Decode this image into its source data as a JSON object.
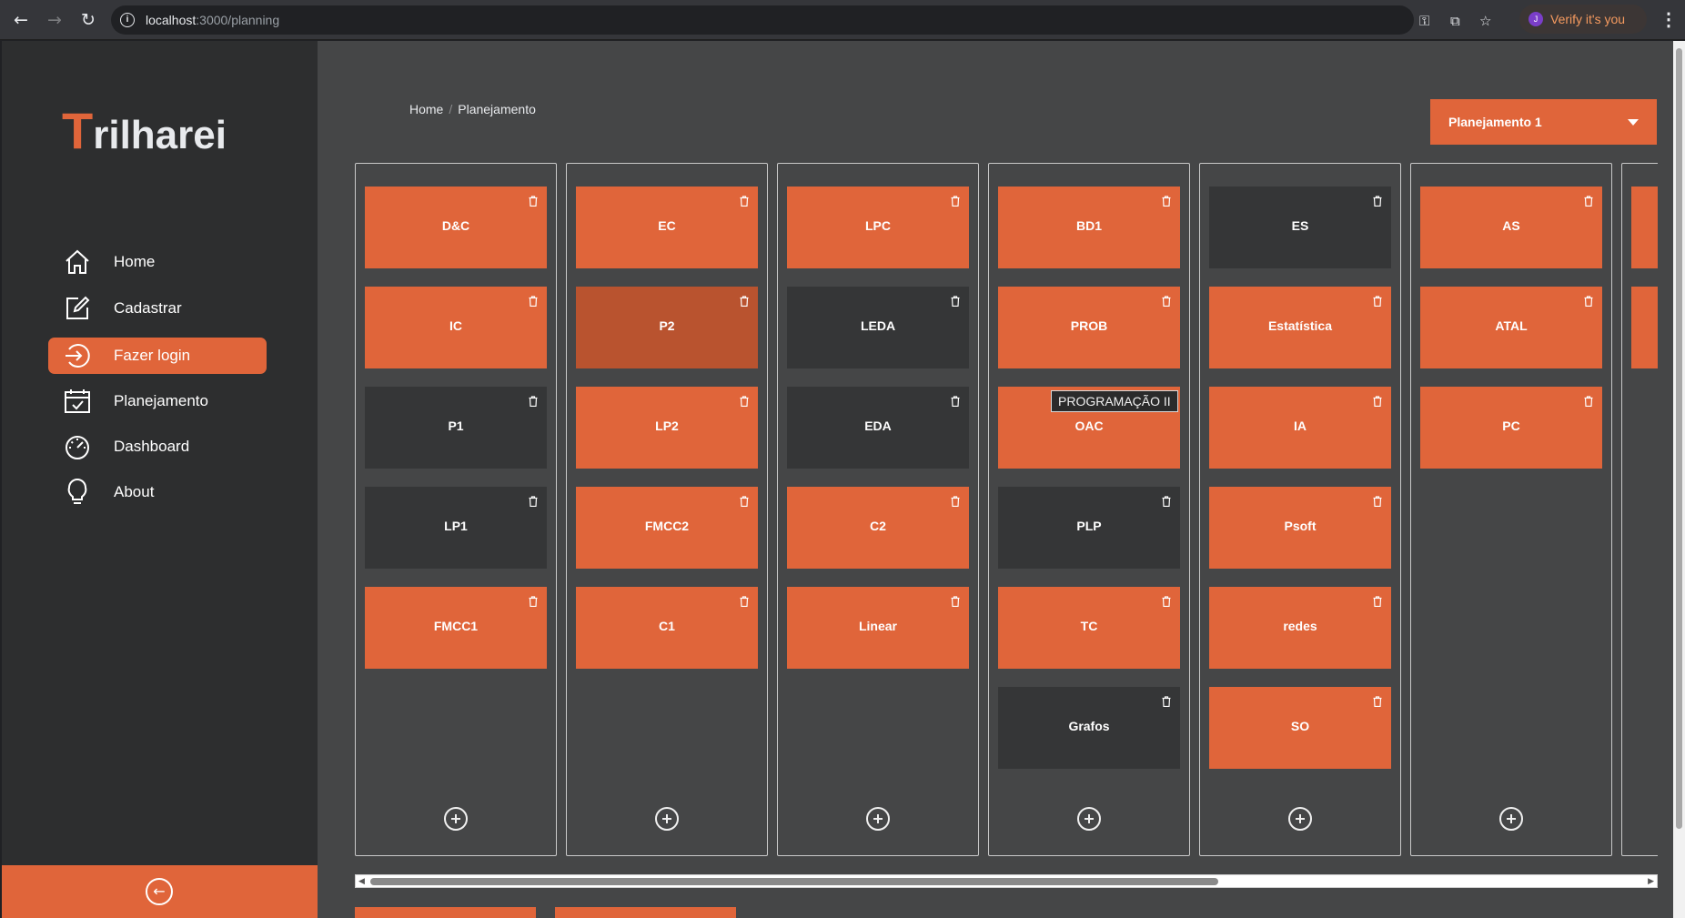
{
  "browser": {
    "url_host": "localhost",
    "url_path": ":3000/planning",
    "verify_label": "Verify it's you",
    "profile_initial": "J"
  },
  "sidebar": {
    "logo_initial": "T",
    "logo_rest": "rilharei",
    "items": [
      {
        "label": "Home",
        "icon": "home-icon"
      },
      {
        "label": "Cadastrar",
        "icon": "edit-icon"
      },
      {
        "label": "Fazer login",
        "icon": "login-icon",
        "active": true
      },
      {
        "label": "Planejamento",
        "icon": "calendar-check-icon"
      },
      {
        "label": "Dashboard",
        "icon": "speedometer-icon"
      },
      {
        "label": "About",
        "icon": "lightbulb-icon"
      }
    ]
  },
  "breadcrumb": {
    "home": "Home",
    "current": "Planejamento"
  },
  "plan_select": {
    "value": "Planejamento 1"
  },
  "columns": [
    {
      "cards": [
        {
          "name": "D&C",
          "style": "orange"
        },
        {
          "name": "IC",
          "style": "orange"
        },
        {
          "name": "P1",
          "style": "dark"
        },
        {
          "name": "LP1",
          "style": "dark"
        },
        {
          "name": "FMCC1",
          "style": "orange"
        }
      ]
    },
    {
      "cards": [
        {
          "name": "EC",
          "style": "orange"
        },
        {
          "name": "P2",
          "style": "hover"
        },
        {
          "name": "LP2",
          "style": "orange"
        },
        {
          "name": "FMCC2",
          "style": "orange"
        },
        {
          "name": "C1",
          "style": "orange"
        }
      ]
    },
    {
      "cards": [
        {
          "name": "LPC",
          "style": "orange"
        },
        {
          "name": "LEDA",
          "style": "dark"
        },
        {
          "name": "EDA",
          "style": "dark"
        },
        {
          "name": "C2",
          "style": "orange"
        },
        {
          "name": "Linear",
          "style": "orange"
        }
      ]
    },
    {
      "cards": [
        {
          "name": "BD1",
          "style": "orange"
        },
        {
          "name": "PROB",
          "style": "orange"
        },
        {
          "name": "OAC",
          "style": "orange"
        },
        {
          "name": "PLP",
          "style": "dark"
        },
        {
          "name": "TC",
          "style": "orange"
        },
        {
          "name": "Grafos",
          "style": "dark"
        }
      ]
    },
    {
      "cards": [
        {
          "name": "ES",
          "style": "dark"
        },
        {
          "name": "Estatística",
          "style": "orange"
        },
        {
          "name": "IA",
          "style": "orange"
        },
        {
          "name": "Psoft",
          "style": "orange"
        },
        {
          "name": "redes",
          "style": "orange"
        },
        {
          "name": "SO",
          "style": "orange"
        }
      ]
    },
    {
      "cards": [
        {
          "name": "AS",
          "style": "orange"
        },
        {
          "name": "ATAL",
          "style": "orange"
        },
        {
          "name": "PC",
          "style": "orange"
        }
      ]
    },
    {
      "cards": [
        {
          "name": "",
          "style": "orange"
        },
        {
          "name": "",
          "style": "orange"
        }
      ]
    }
  ],
  "tooltip": "PROGRAMAÇÃO II",
  "colors": {
    "accent": "#e0653a",
    "card_dark": "#353637",
    "main_bg": "#454647",
    "sidebar_bg": "#2d2e2f"
  }
}
